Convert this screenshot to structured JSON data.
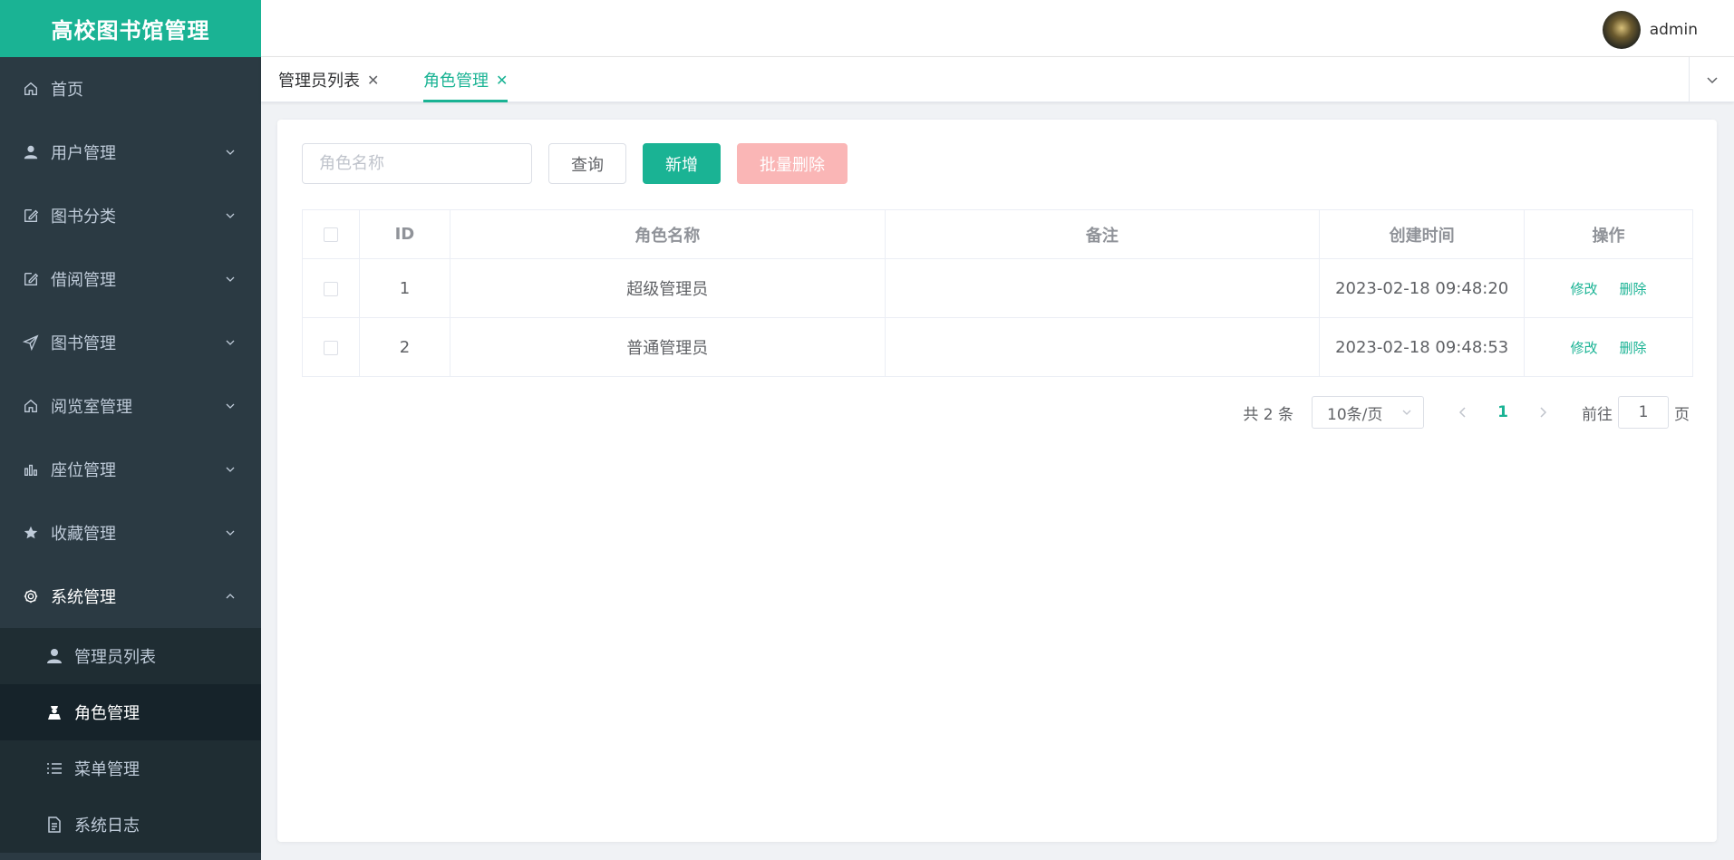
{
  "app": {
    "title": "高校图书馆管理"
  },
  "header": {
    "username": "admin"
  },
  "sidebar": {
    "items": [
      {
        "label": "首页",
        "icon": "home-icon"
      },
      {
        "label": "用户管理",
        "icon": "user-icon"
      },
      {
        "label": "图书分类",
        "icon": "edit-icon"
      },
      {
        "label": "借阅管理",
        "icon": "edit-icon"
      },
      {
        "label": "图书管理",
        "icon": "send-icon"
      },
      {
        "label": "阅览室管理",
        "icon": "home-icon"
      },
      {
        "label": "座位管理",
        "icon": "chart-icon"
      },
      {
        "label": "收藏管理",
        "icon": "star-icon"
      },
      {
        "label": "系统管理",
        "icon": "gear-icon"
      }
    ],
    "submenu": [
      {
        "label": "管理员列表",
        "icon": "user-icon"
      },
      {
        "label": "角色管理",
        "icon": "role-icon"
      },
      {
        "label": "菜单管理",
        "icon": "list-icon"
      },
      {
        "label": "系统日志",
        "icon": "document-icon"
      }
    ]
  },
  "tabs": [
    {
      "label": "管理员列表"
    },
    {
      "label": "角色管理"
    }
  ],
  "toolbar": {
    "search_placeholder": "角色名称",
    "query_label": "查询",
    "add_label": "新增",
    "batch_delete_label": "批量删除"
  },
  "table": {
    "headers": [
      "ID",
      "角色名称",
      "备注",
      "创建时间",
      "操作"
    ],
    "rows": [
      {
        "id": "1",
        "name": "超级管理员",
        "remark": "",
        "created": "2023-02-18 09:48:20",
        "edit": "修改",
        "delete": "删除"
      },
      {
        "id": "2",
        "name": "普通管理员",
        "remark": "",
        "created": "2023-02-18 09:48:53",
        "edit": "修改",
        "delete": "删除"
      }
    ]
  },
  "pagination": {
    "total_text": "共 2 条",
    "page_size": "10条/页",
    "current_page": "1",
    "goto_prefix": "前往",
    "goto_value": "1",
    "goto_suffix": "页"
  },
  "colors": {
    "accent": "#1ab394",
    "sidebar_bg": "#2b3a43",
    "danger_disabled": "#fab6b6"
  }
}
